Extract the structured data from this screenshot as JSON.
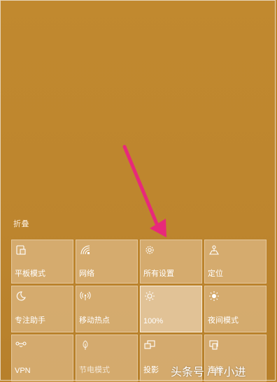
{
  "action_center": {
    "collapse_label": "折叠",
    "tiles": [
      {
        "label": "平板模式",
        "icon": "tablet-mode-icon",
        "active": false
      },
      {
        "label": "网络",
        "icon": "network-icon",
        "active": false
      },
      {
        "label": "所有设置",
        "icon": "gear-icon",
        "active": false
      },
      {
        "label": "定位",
        "icon": "location-icon",
        "active": false
      },
      {
        "label": "专注助手",
        "icon": "moon-icon",
        "active": false
      },
      {
        "label": "移动热点",
        "icon": "hotspot-icon",
        "active": false
      },
      {
        "label": "100%",
        "icon": "brightness-icon",
        "active": true
      },
      {
        "label": "夜间模式",
        "icon": "night-light-icon",
        "active": false
      },
      {
        "label": "VPN",
        "icon": "vpn-icon",
        "active": false
      },
      {
        "label": "节电模式",
        "icon": "battery-saver-icon",
        "active": false
      },
      {
        "label": "投影",
        "icon": "project-icon",
        "active": false
      },
      {
        "label": "连接",
        "icon": "connect-icon",
        "active": false
      }
    ]
  },
  "annotation": {
    "arrow_color": "#e8297a",
    "arrow_target": "所有设置"
  },
  "watermark": {
    "text": "头条号 / IT小进"
  },
  "colors": {
    "background": "#c0862e",
    "tile": "#d9b27a",
    "tile_active": "#e6cba5",
    "text": "#ffffff"
  }
}
